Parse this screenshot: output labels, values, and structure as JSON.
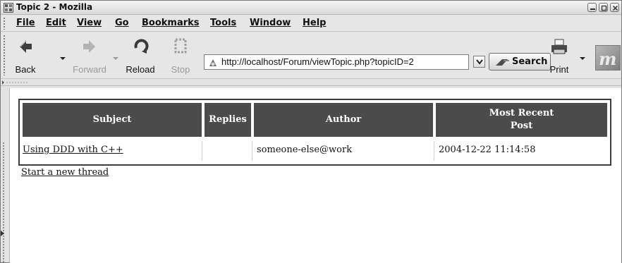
{
  "window": {
    "title": "Topic 2 - Mozilla"
  },
  "menu": {
    "items": [
      "File",
      "Edit",
      "View",
      "Go",
      "Bookmarks",
      "Tools",
      "Window",
      "Help"
    ]
  },
  "toolbar": {
    "back": "Back",
    "forward": "Forward",
    "reload": "Reload",
    "stop": "Stop",
    "url": "http://localhost/Forum/viewTopic.php?topicID=2",
    "search": "Search",
    "print": "Print"
  },
  "topic_table": {
    "headers": [
      "Subject",
      "Replies",
      "Author",
      "Most Recent Post"
    ],
    "header_most_recent_line1": "Most Recent",
    "header_most_recent_line2": "Post",
    "rows": [
      {
        "subject": "Using DDD with C++",
        "replies": "",
        "author": "someone-else@work",
        "most_recent_post": "2004-12-22 11:14:58"
      }
    ]
  },
  "links": {
    "new_thread": "Start a new thread"
  },
  "colors": {
    "header_bg": "#4b4b4b",
    "header_text": "#ffffff",
    "chrome": "#e6e6e6"
  }
}
